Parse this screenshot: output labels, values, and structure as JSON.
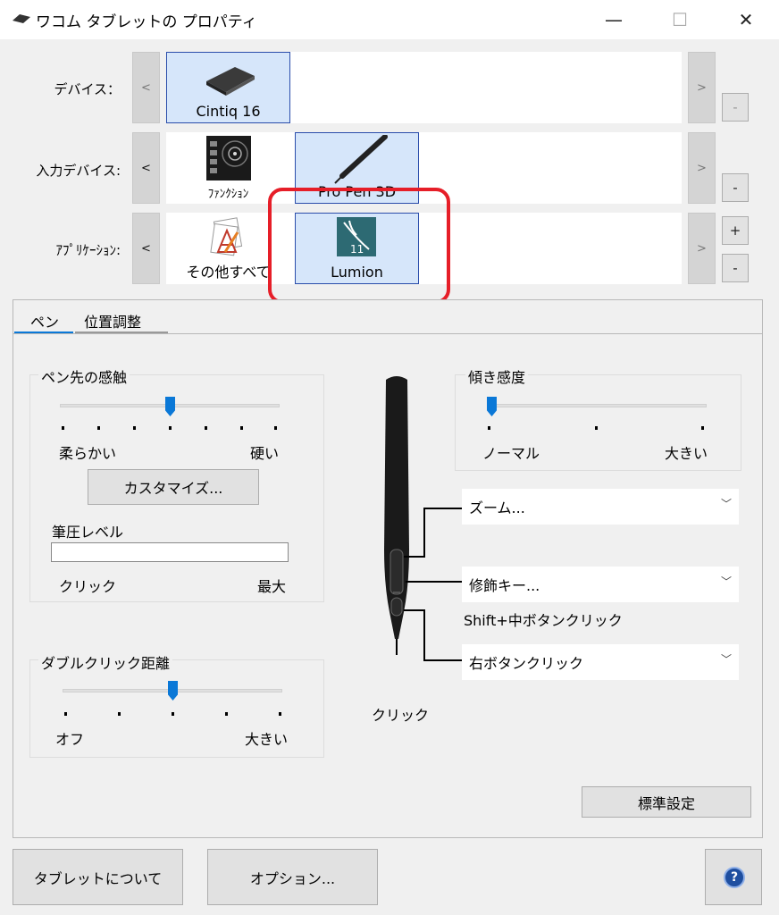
{
  "window": {
    "title": "ワコム タブレットの プロパティ",
    "minimize": "—",
    "maximize": "☐",
    "close": "✕"
  },
  "rows": {
    "device_label": "デバイス：",
    "input_label": "入力デバイス:",
    "app_label": "ｱﾌﾟﾘｹｰｼｮﾝ:",
    "nav_prev": "<",
    "nav_next": ">",
    "plus": "+",
    "minus": "-"
  },
  "devices": [
    {
      "label": "Cintiq 16",
      "selected": true
    }
  ],
  "input_devices": [
    {
      "label": "ﾌｧﾝｸｼｮﾝ",
      "selected": false
    },
    {
      "label": "Pro Pen 3D",
      "selected": true
    }
  ],
  "applications": [
    {
      "label": "その他すべて",
      "selected": false
    },
    {
      "label": "Lumion",
      "selected": true
    }
  ],
  "tabs": [
    {
      "label": "ペン",
      "active": true
    },
    {
      "label": "位置調整",
      "active": false
    }
  ],
  "tip_feel": {
    "title": "ペン先の感触",
    "soft": "柔らかい",
    "firm": "硬い",
    "level": 0.5,
    "customize": "カスタマイズ...",
    "pressure_title": "筆圧レベル",
    "pressure_value": 0,
    "click": "クリック",
    "max": "最大"
  },
  "double_click": {
    "title": "ダブルクリック距離",
    "off": "オフ",
    "large": "大きい",
    "level": 0.5
  },
  "tilt": {
    "title": "傾き感度",
    "normal": "ノーマル",
    "large": "大きい",
    "level": 0.0
  },
  "pen_buttons": {
    "upper": "ズーム...",
    "middle": "修飾キー...",
    "middle_detail": "Shift+中ボタンクリック",
    "lower": "右ボタンクリック",
    "tip": "クリック",
    "chevron": "﹀"
  },
  "default_button": "標準設定",
  "footer": {
    "about": "タブレットについて",
    "options": "オプション...",
    "help": "?"
  },
  "colors": {
    "accent": "#0a78d7",
    "highlight": "#e61e28",
    "selected_tile": "#d6e6fa"
  }
}
